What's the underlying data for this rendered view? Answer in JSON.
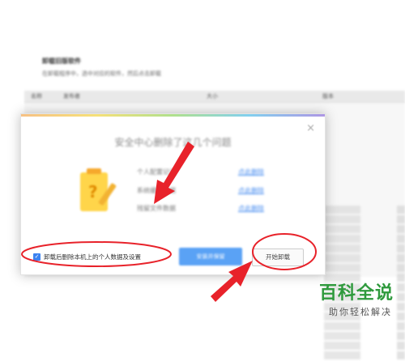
{
  "background": {
    "heading": "卸载旧版软件",
    "subtext": "在卸载程序中，选中对应的软件，然后点击卸载",
    "table_headers": [
      "名称",
      "发布者",
      "大小",
      "版本"
    ]
  },
  "dialog": {
    "title": "安全中心删除了这几个问题",
    "options": [
      {
        "label": "个人配置记录",
        "link": "点此删除"
      },
      {
        "label": "系统缓存数据",
        "link": "点此删除"
      },
      {
        "label": "残留文件数据",
        "link": "点此删除"
      }
    ],
    "keep_data_label": "卸载后删除本机上的个人数据及设置",
    "keep_data_checked": true,
    "primary_button": "安装并保留",
    "start_uninstall_button": "开始卸载"
  },
  "watermark": {
    "brand": "百科全说",
    "slogan": "助你轻松解决"
  },
  "colors": {
    "annotation_red": "#e8222a",
    "accent_blue": "#3b82f0",
    "brand_green": "#2f9a3d"
  }
}
